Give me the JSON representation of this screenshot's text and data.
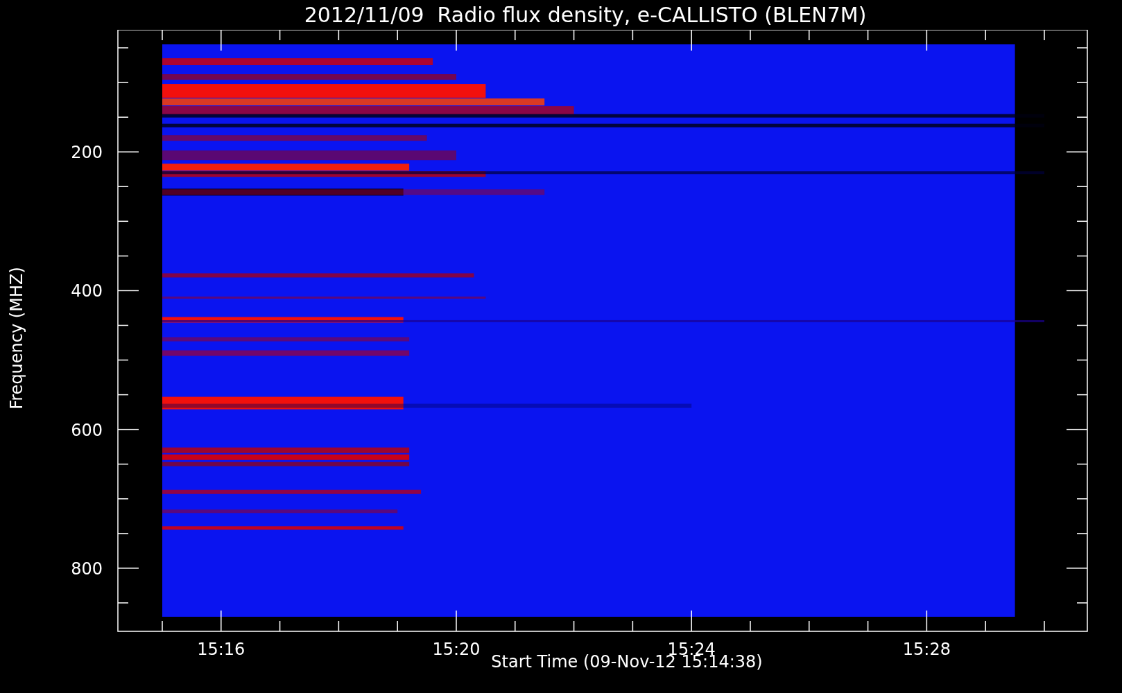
{
  "title": "2012/11/09  Radio flux density, e-CALLISTO (BLEN7M)",
  "y_axis": {
    "label": "Frequency (MHZ)",
    "ticks": [
      "200",
      "400",
      "600",
      "800"
    ]
  },
  "x_axis": {
    "label": "Start Time (09-Nov-12 15:14:38)",
    "ticks": [
      "15:16",
      "15:20",
      "15:24",
      "15:28"
    ]
  }
}
